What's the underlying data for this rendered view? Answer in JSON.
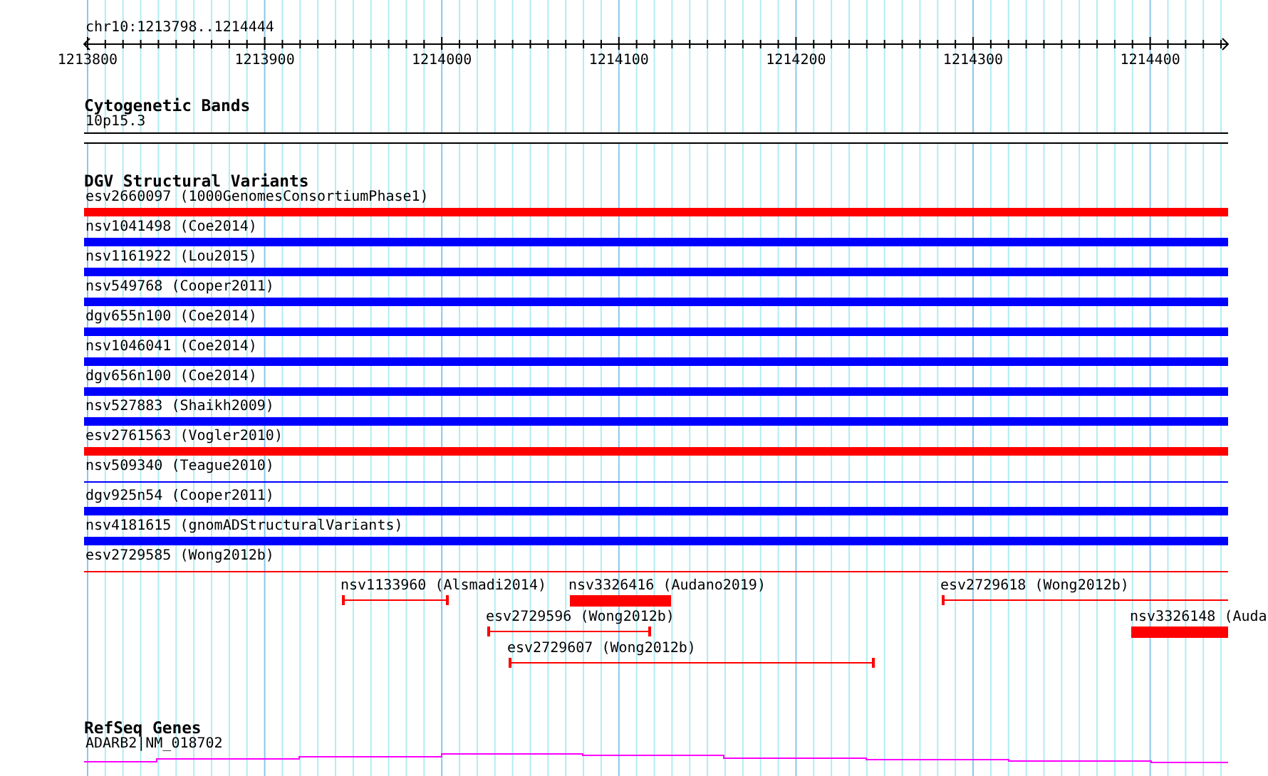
{
  "ruler": {
    "position": "chr10:1213798..1214444",
    "ticks": [
      "1213800",
      "1213900",
      "1214000",
      "1214100",
      "1214200",
      "1214300",
      "1214400"
    ]
  },
  "cytogenetic_bands": {
    "title": "Cytogenetic Bands",
    "band": "10p15.3"
  },
  "dgv_structural_variants": {
    "title": "DGV Structural Variants",
    "variants": [
      {
        "label": "esv2660097 (1000GenomesConsortiumPhase1)",
        "color": "#ff0000",
        "kind": "bar"
      },
      {
        "label": "nsv1041498 (Coe2014)",
        "color": "#0000ff",
        "kind": "bar"
      },
      {
        "label": "nsv1161922 (Lou2015)",
        "color": "#0000ff",
        "kind": "bar"
      },
      {
        "label": "nsv549768 (Cooper2011)",
        "color": "#0000ff",
        "kind": "bar"
      },
      {
        "label": "dgv655n100 (Coe2014)",
        "color": "#0000ff",
        "kind": "bar"
      },
      {
        "label": "nsv1046041 (Coe2014)",
        "color": "#0000ff",
        "kind": "bar"
      },
      {
        "label": "dgv656n100 (Coe2014)",
        "color": "#0000ff",
        "kind": "bar"
      },
      {
        "label": "nsv527883 (Shaikh2009)",
        "color": "#0000ff",
        "kind": "bar"
      },
      {
        "label": "esv2761563 (Vogler2010)",
        "color": "#ff0000",
        "kind": "bar"
      },
      {
        "label": "nsv509340 (Teague2010)",
        "color": "#0000ff",
        "kind": "line"
      },
      {
        "label": "dgv925n54 (Cooper2011)",
        "color": "#0000ff",
        "kind": "bar"
      },
      {
        "label": "nsv4181615 (gnomADStructuralVariants)",
        "color": "#0000ff",
        "kind": "bar"
      },
      {
        "label": "esv2729585 (Wong2012b)",
        "color": "#ff0000",
        "kind": "line"
      }
    ],
    "packed_rows": [
      [
        {
          "label": "nsv1133960 (Alsmadi2014)",
          "color": "#ff0000",
          "kind": "range"
        },
        {
          "label": "nsv3326416 (Audano2019)",
          "color": "#ff0000",
          "kind": "bar"
        },
        {
          "label": "esv2729618 (Wong2012b)",
          "color": "#ff0000",
          "kind": "range"
        }
      ],
      [
        {
          "label": "esv2729596 (Wong2012b)",
          "color": "#ff0000",
          "kind": "range"
        },
        {
          "label": "nsv3326148 (Auda",
          "color": "#ff0000",
          "kind": "bar"
        }
      ],
      [
        {
          "label": "esv2729607 (Wong2012b)",
          "color": "#ff0000",
          "kind": "range"
        }
      ]
    ]
  },
  "refseq_genes": {
    "title": "RefSeq Genes",
    "gene": "ADARB2|NM_018702"
  }
}
